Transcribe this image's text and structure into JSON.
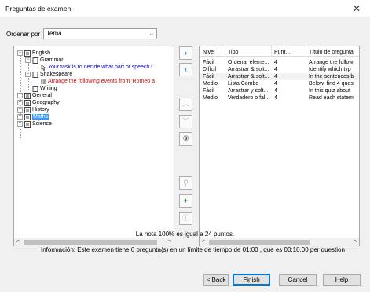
{
  "window": {
    "title": "Preguntas de examen",
    "close_glyph": "✕"
  },
  "order": {
    "label": "Ordenar por",
    "value": "Tema"
  },
  "tree": {
    "nodes": [
      {
        "label": "English",
        "expander": "−",
        "icon": "list-icon"
      },
      {
        "label": "Grammar",
        "expander": "−",
        "icon": "doc-icon"
      },
      {
        "label": "Your task is to decide what part of speech t",
        "icon": "drag-icon",
        "color": "#0000cc"
      },
      {
        "label": "Shakespeare",
        "expander": "−",
        "icon": "doc-icon"
      },
      {
        "label": "Arrange the following events from 'Romeo a",
        "icon": "order-icon",
        "color": "#cc0000"
      },
      {
        "label": "Writing",
        "icon": "doc-icon"
      },
      {
        "label": "General",
        "expander": "+",
        "icon": "list-icon"
      },
      {
        "label": "Geography",
        "expander": "+",
        "icon": "list-icon"
      },
      {
        "label": "History",
        "expander": "+",
        "icon": "list-icon"
      },
      {
        "label": "Maths",
        "expander": "+",
        "icon": "list-icon",
        "selected": true
      },
      {
        "label": "Science",
        "expander": "+",
        "icon": "list-icon"
      }
    ]
  },
  "side_buttons": {
    "add": {
      "glyph": "›",
      "icon": "chevron-right-icon"
    },
    "remove": {
      "glyph": "‹",
      "icon": "chevron-left-icon"
    },
    "up": {
      "glyph": "︿",
      "icon": "chevron-up-icon"
    },
    "down": {
      "glyph": "﹀",
      "icon": "chevron-down-icon"
    },
    "number": {
      "glyph": "③",
      "icon": "number-icon"
    },
    "search": {
      "glyph": "⚲",
      "icon": "search-icon"
    },
    "new": {
      "glyph": "+",
      "icon": "plus-icon"
    },
    "info": {
      "glyph": "ⓘ",
      "icon": "info-icon"
    }
  },
  "grid": {
    "columns": [
      "Nivel",
      "Tipo",
      "Punt...",
      "Título de pregunta"
    ],
    "rows": [
      [
        "Fácil",
        "Ordenar eleme...",
        "4",
        "Arrange the follow"
      ],
      [
        "Difícil",
        "Arrastrar & solt...",
        "4",
        "Identify which typ"
      ],
      [
        "Fácil",
        "Arrastrar & solt...",
        "4",
        "In the sentences b"
      ],
      [
        "Medio",
        "Lista Combo",
        "4",
        "Below, find 4 ques"
      ],
      [
        "Fácil",
        "Arrastrar y solt...",
        "4",
        "In this quiz about"
      ],
      [
        "Medio",
        "Verdadero o fal...",
        "4",
        "Read each statem"
      ]
    ]
  },
  "score_note": "La nota 100% es igual a 24 puntos.",
  "info_note": "Información: Este examen tiene 6 pregunta(s) en un límite de tiempo de 01:00 , que es 00:10.00 per question",
  "buttons": {
    "back": "< Back",
    "finish": "Finish",
    "cancel": "Cancel",
    "help": "Help"
  },
  "colors": {
    "selection": "#3399ff",
    "accent": "#1a7fd4",
    "dialog_bg": "#f0f0f0"
  }
}
